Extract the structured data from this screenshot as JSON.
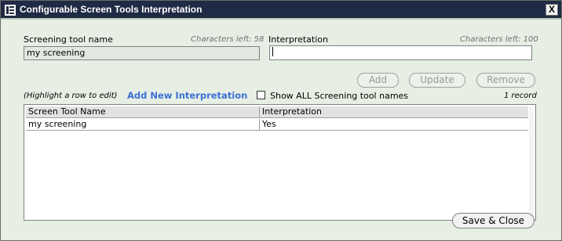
{
  "window": {
    "title": "Configurable Screen Tools Interpretation",
    "close_label": "X"
  },
  "form": {
    "screening_tool": {
      "label": "Screening tool name",
      "chars_left": "Characters left: 58",
      "value": "my screening"
    },
    "interpretation": {
      "label": "Interpretation",
      "chars_left": "Characters left: 100",
      "value": ""
    },
    "buttons": {
      "add": "Add",
      "update": "Update",
      "remove": "Remove",
      "save_close": "Save & Close"
    },
    "highlight_hint": "(Highlight a row to edit)",
    "add_new_link": "Add New Interpretation",
    "show_all": {
      "label": "Show ALL Screening tool names",
      "checked": false
    },
    "record_count": "1 record"
  },
  "grid": {
    "headers": [
      "Screen Tool Name",
      "Interpretation"
    ],
    "rows": [
      [
        "my screening",
        "Yes"
      ]
    ]
  },
  "colors": {
    "titlebar": "#1f2a44",
    "background": "#e7efe5",
    "link": "#3c6fd6"
  }
}
